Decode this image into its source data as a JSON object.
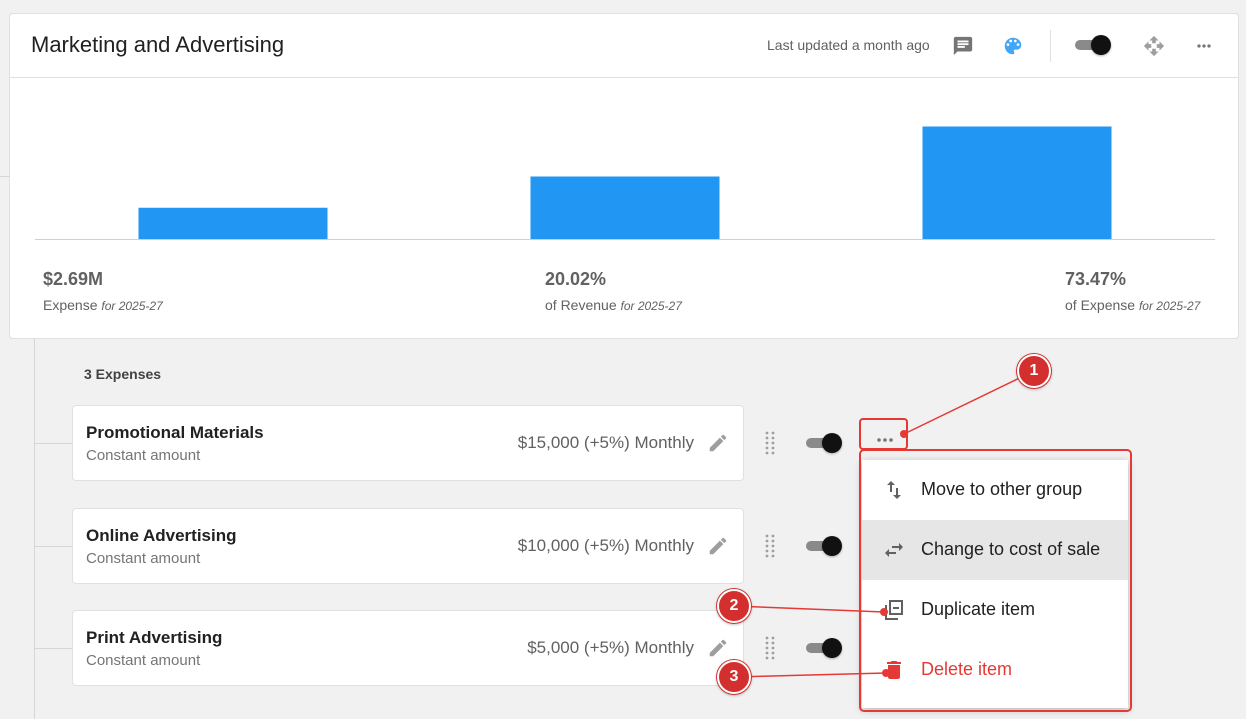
{
  "card": {
    "title": "Marketing and Advertising",
    "last_updated": "Last updated a month ago",
    "icons": [
      "comment-icon",
      "palette-icon",
      "move-icon",
      "more-horiz-icon"
    ],
    "toggle_on": true
  },
  "chart_data": {
    "type": "bar",
    "categories": [
      "Expense",
      "of Revenue",
      "of Expense"
    ],
    "values": [
      0.25,
      0.5,
      0.9
    ],
    "color": "#2196f3"
  },
  "stats": [
    {
      "value": "$2.69M",
      "label": "Expense",
      "period": "for 2025-27"
    },
    {
      "value": "20.02%",
      "label": "of Revenue",
      "period": "for 2025-27"
    },
    {
      "value": "73.47%",
      "label": "of Expense",
      "period": "for 2025-27"
    }
  ],
  "expenses": {
    "count_label": "3 Expenses",
    "items": [
      {
        "name": "Promotional Materials",
        "type": "Constant amount",
        "amount": "$15,000 (+5%) Monthly",
        "enabled": true
      },
      {
        "name": "Online Advertising",
        "type": "Constant amount",
        "amount": "$10,000 (+5%) Monthly",
        "enabled": true
      },
      {
        "name": "Print Advertising",
        "type": "Constant amount",
        "amount": "$5,000 (+5%) Monthly",
        "enabled": true
      }
    ]
  },
  "menu": {
    "items": [
      {
        "label": "Move to other group",
        "icon": "swap-vert-icon"
      },
      {
        "label": "Change to cost of sale",
        "icon": "swap-horiz-icon",
        "highlighted": true
      },
      {
        "label": "Duplicate item",
        "icon": "duplicate-icon"
      },
      {
        "label": "Delete item",
        "icon": "delete-icon",
        "danger": true
      }
    ]
  },
  "annotations": [
    "1",
    "2",
    "3"
  ],
  "colors": {
    "accent": "#2196f3",
    "annotation": "#d32f2f",
    "danger": "#e53935"
  }
}
